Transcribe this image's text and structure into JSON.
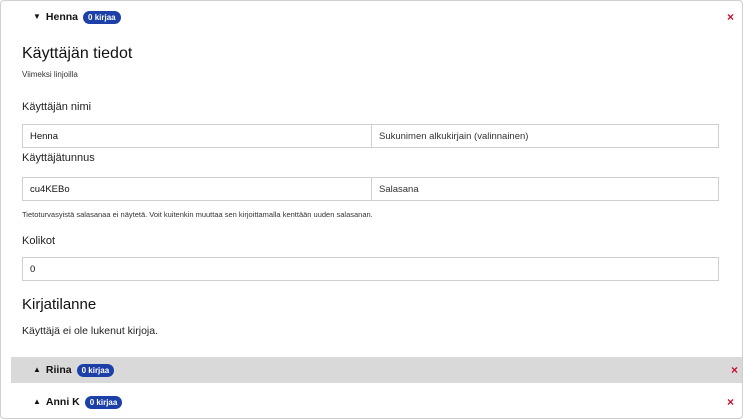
{
  "users": [
    {
      "name": "Henna",
      "badge": "0 kirjaa",
      "expanded": true
    },
    {
      "name": "Riina",
      "badge": "0 kirjaa",
      "expanded": false
    },
    {
      "name": "Anni K",
      "badge": "0 kirjaa",
      "expanded": false
    }
  ],
  "close_symbol": "×",
  "toggle_expanded_symbol": "▼",
  "toggle_collapsed_symbol": "▲",
  "details": {
    "title": "Käyttäjän tiedot",
    "subtitle": "Viimeksi linjoilla",
    "name_label": "Käyttäjän nimi",
    "first_name_value": "Henna",
    "last_initial_placeholder": "Sukunimen alkukirjain (valinnainen)",
    "username_label": "Käyttäjätunnus",
    "username_value": "cu4KEBo",
    "password_placeholder": "Salasana",
    "password_note": "Tietoturvasyistä salasanaa ei näytetä. Voit kuitenkin muuttaa sen kirjoittamalla kenttään uuden salasanan.",
    "coins_label": "Kolikot",
    "coins_value": "0"
  },
  "reading": {
    "title": "Kirjatilanne",
    "status": "Käyttäjä ei ole lukenut kirjoja."
  },
  "colors": {
    "badge": "#1c3fa8",
    "close": "#c8102e",
    "collapsed_row_bg": "#d9d9d9"
  }
}
